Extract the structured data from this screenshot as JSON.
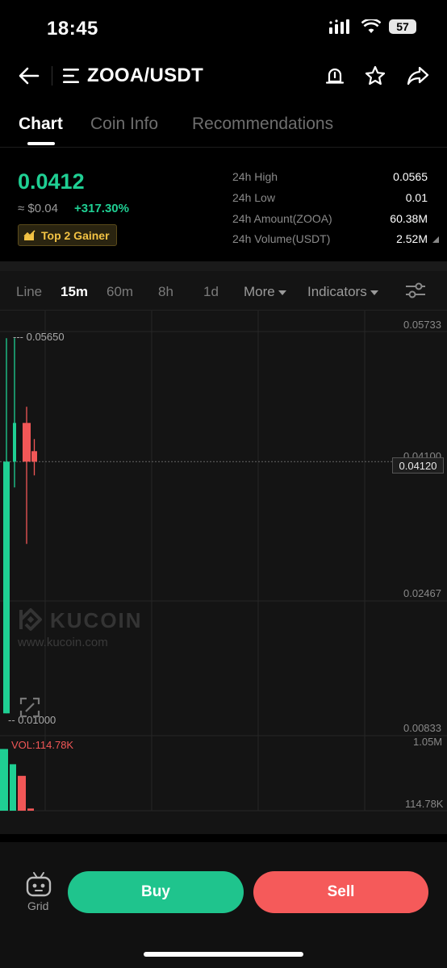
{
  "status": {
    "time": "18:45",
    "battery": "57"
  },
  "header": {
    "pair": "ZOOA/USDT"
  },
  "tabs": [
    {
      "label": "Chart",
      "active": true
    },
    {
      "label": "Coin Info",
      "active": false
    },
    {
      "label": "Recommendations",
      "active": false
    }
  ],
  "ticker": {
    "price": "0.0412",
    "approx": "≈ $0.04",
    "change": "+317.30%",
    "badge": "Top 2 Gainer",
    "stats": [
      {
        "label": "24h High",
        "value": "0.0565"
      },
      {
        "label": "24h Low",
        "value": "0.01"
      },
      {
        "label": "24h Amount(ZOOA)",
        "value": "60.38M"
      },
      {
        "label": "24h Volume(USDT)",
        "value": "2.52M"
      }
    ]
  },
  "intervals": [
    {
      "label": "Line",
      "active": false
    },
    {
      "label": "15m",
      "active": true
    },
    {
      "label": "60m",
      "active": false
    },
    {
      "label": "8h",
      "active": false
    },
    {
      "label": "1d",
      "active": false
    }
  ],
  "toolbar": {
    "more_label": "More",
    "indicators_label": "Indicators"
  },
  "chart_data": {
    "type": "candlestick",
    "price_axis_ticks": [
      "0.05733",
      "0.04100",
      "0.02467",
      "0.00833"
    ],
    "current_price": "0.04120",
    "high_marker": "0.05650",
    "low_marker": "0.01000",
    "volume_label": "VOL:114.78K",
    "volume_axis_ticks": [
      "1.05M",
      "114.78K"
    ],
    "candles": [
      {
        "open": 0.01,
        "high": 0.0565,
        "low": 0.01,
        "close": 0.0412,
        "direction": "up"
      },
      {
        "open": 0.0412,
        "high": 0.0565,
        "low": 0.038,
        "close": 0.046,
        "direction": "up"
      },
      {
        "open": 0.046,
        "high": 0.048,
        "low": 0.031,
        "close": 0.0412,
        "direction": "down"
      },
      {
        "open": 0.0425,
        "high": 0.044,
        "low": 0.0395,
        "close": 0.0412,
        "direction": "down"
      }
    ],
    "volumes": [
      0.85,
      0.64,
      0.48,
      0.03
    ],
    "colors": {
      "up": "#1fcf93",
      "down": "#f25757"
    }
  },
  "watermark": {
    "brand": "KUCOIN",
    "url": "www.kucoin.com"
  },
  "bottom": {
    "grid_label": "Grid",
    "buy_label": "Buy",
    "sell_label": "Sell"
  }
}
